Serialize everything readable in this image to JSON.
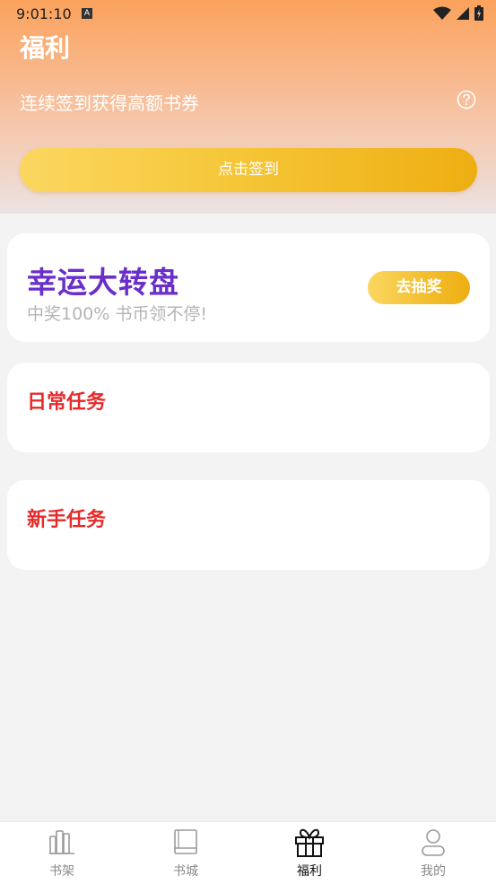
{
  "status_bar": {
    "time": "9:01:10",
    "a_badge": "A"
  },
  "header": {
    "title": "福利",
    "subtitle": "连续签到获得高额书券",
    "signin_label": "点击签到"
  },
  "lottery": {
    "title": "幸运大转盘",
    "subtitle": "中奖100% 书币领不停!",
    "button_label": "去抽奖"
  },
  "tasks": {
    "daily_title": "日常任务",
    "newbie_title": "新手任务"
  },
  "tabbar": {
    "items": [
      {
        "label": "书架",
        "icon": "bookshelf-icon"
      },
      {
        "label": "书城",
        "icon": "book-icon"
      },
      {
        "label": "福利",
        "icon": "gift-icon"
      },
      {
        "label": "我的",
        "icon": "person-icon"
      }
    ],
    "active_index": 2
  },
  "colors": {
    "header_top": "#fba25c",
    "accent_yellow": "#f5c535",
    "lottery_purple": "#6a2ecb",
    "task_red": "#e52b2b"
  }
}
